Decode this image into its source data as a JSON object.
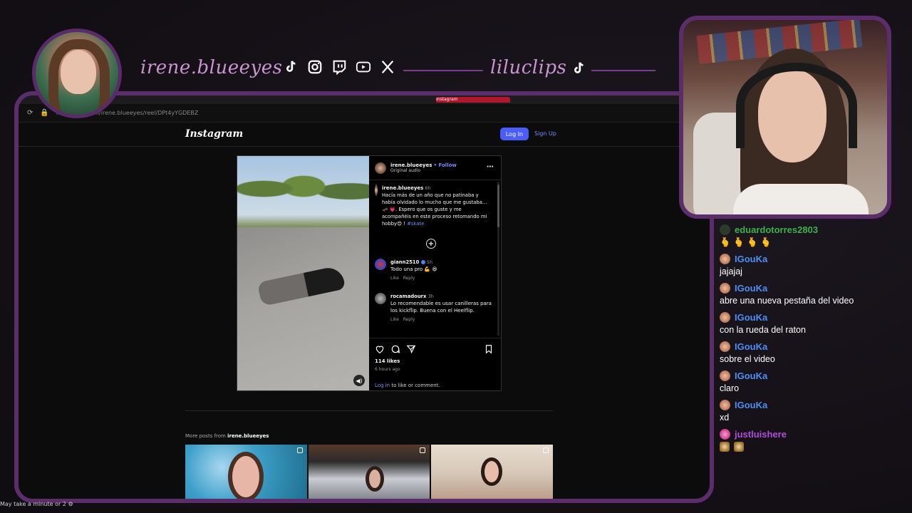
{
  "overlay": {
    "handle_main": "irene.blueeyes",
    "handle_clips": "liluclips",
    "social_icons": [
      "tiktok-icon",
      "instagram-icon",
      "twitch-icon",
      "youtube-icon",
      "x-icon"
    ]
  },
  "browser": {
    "tabs": [
      "",
      "",
      "",
      "",
      "",
      "",
      "Instagram"
    ],
    "url": "instagram.com/irene.blueeyes/reel/DPt4yYGDEBZ"
  },
  "instagram": {
    "logo": "Instagram",
    "login_label": "Log In",
    "signup_label": "Sign Up",
    "post": {
      "username": "irene.blueeyes",
      "follow_label": "• Follow",
      "audio": "Original audio",
      "caption_user": "irene.blueeyes",
      "caption_time": "6h",
      "caption_text": "Hacía más de un año que no patinaba y había olvidado lo mucho que me gustaba... 🛹 💗. Espero que os guste y me acompañéis en este proceso retomando mi hobby😍 ! ",
      "caption_tag": "#skate",
      "comments": [
        {
          "user": "giann2510",
          "time": "5h",
          "text": "Todo una pro 💪 😆",
          "like": "Like",
          "reply": "Reply"
        },
        {
          "user": "rocamadourx",
          "time": "3h",
          "text": "Lo recomendable es usar canilleras para los kickflip. Buena con el Heelflip.",
          "like": "Like",
          "reply": "Reply"
        }
      ],
      "likes": "114 likes",
      "posted": "6 hours ago",
      "login_link": "Log in",
      "login_rest": " to like or comment."
    },
    "more_posts_prefix": "More posts from ",
    "more_posts_user": "irene.blueeyes"
  },
  "status_bar": "May take a minute or 2 ⚙",
  "chat": {
    "messages": [
      {
        "user": "eduardotorres2803",
        "color": "#3bb24c",
        "text": "🫰 🫰 🫰 🫰"
      },
      {
        "user": "IGouKa",
        "color": "#4d8ff5",
        "text": "jajajaj"
      },
      {
        "user": "IGouKa",
        "color": "#4d8ff5",
        "text": "abre una nueva pestaña del video"
      },
      {
        "user": "IGouKa",
        "color": "#4d8ff5",
        "text": "con la rueda del raton"
      },
      {
        "user": "IGouKa",
        "color": "#4d8ff5",
        "text": "sobre el video"
      },
      {
        "user": "IGouKa",
        "color": "#4d8ff5",
        "text": "claro"
      },
      {
        "user": "IGouKa",
        "color": "#4d8ff5",
        "text": "xd"
      },
      {
        "user": "justluishere",
        "color": "#b24de0",
        "text": ""
      }
    ]
  }
}
